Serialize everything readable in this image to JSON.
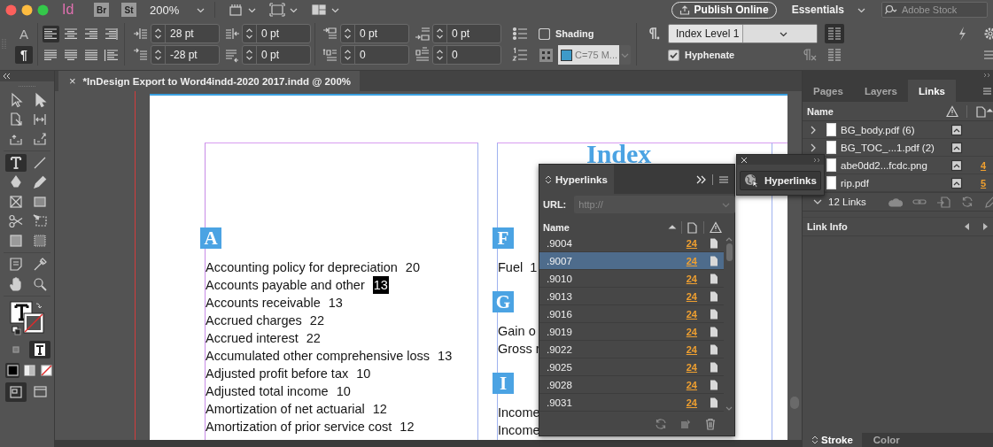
{
  "app_bar": {
    "logo": "Id",
    "apps": [
      "Br",
      "St"
    ],
    "zoom": "200%",
    "publish_button": "Publish Online",
    "workspace": "Essentials",
    "stock_search": {
      "placeholder": "Adobe Stock"
    }
  },
  "control_bar": {
    "modes": [
      {
        "label": "A",
        "selected": false
      },
      {
        "label": "¶",
        "selected": true
      }
    ],
    "alignment": [
      {
        "selected": true
      },
      {
        "selected": false
      },
      {
        "selected": false
      },
      {
        "selected": false
      },
      {
        "selected": false
      },
      {
        "selected": false
      },
      {
        "selected": false
      },
      {
        "selected": false
      }
    ],
    "spacing_fields": [
      {
        "value": "28 pt"
      },
      {
        "value": "-28 pt"
      },
      {
        "value": "0 pt"
      },
      {
        "value": "0 pt"
      },
      {
        "value": "0 pt"
      },
      {
        "value": "0"
      },
      {
        "value": "0 pt"
      },
      {
        "value": "0"
      }
    ],
    "shading": {
      "label": "Shading",
      "checked": false
    },
    "shading_color": {
      "value": "C=75 M..."
    },
    "paragraph_style": {
      "value": "Index Level 1"
    },
    "hyphenate": {
      "label": "Hyphenate",
      "checked": true
    },
    "column_modes": [
      {
        "selected": true
      },
      {
        "selected": false
      }
    ]
  },
  "document_tab": {
    "close": "×",
    "title": "*InDesign Export to Word4indd-2020 2017.indd @ 200%"
  },
  "tool_groups": [
    [
      {
        "kind": "selection",
        "selected": false
      },
      {
        "kind": "direct",
        "selected": false
      },
      {
        "kind": "page",
        "selected": false
      },
      {
        "kind": "gap",
        "selected": false
      },
      {
        "kind": "collector",
        "selected": false
      },
      {
        "kind": "placer",
        "selected": false
      }
    ],
    [
      {
        "kind": "type",
        "selected": true
      },
      {
        "kind": "line",
        "selected": false
      },
      {
        "kind": "pen",
        "selected": false
      },
      {
        "kind": "pencil",
        "selected": false
      },
      {
        "kind": "frame",
        "selected": false
      },
      {
        "kind": "rect",
        "selected": false
      },
      {
        "kind": "scissors",
        "selected": false
      },
      {
        "kind": "transform",
        "selected": false
      },
      {
        "kind": "gradient",
        "selected": false
      },
      {
        "kind": "feather",
        "selected": false
      }
    ],
    [
      {
        "kind": "note",
        "selected": false
      },
      {
        "kind": "eyedropper",
        "selected": false
      },
      {
        "kind": "hand",
        "selected": false
      },
      {
        "kind": "zoom",
        "selected": false
      }
    ]
  ],
  "format_targets": [
    {
      "selected": false
    },
    {
      "selected": true
    }
  ],
  "apply_modes": [
    {
      "selected": true
    },
    {
      "selected": false
    },
    {
      "selected": false
    }
  ],
  "view_modes": [
    {
      "selected": true
    },
    {
      "selected": false
    }
  ],
  "page": {
    "title": "Index",
    "left_column": [
      {
        "letter": "A",
        "entries": [
          {
            "term": "Accounting policy for depreciation",
            "page": "20",
            "highlighted": false
          },
          {
            "term": "Accounts payable and other",
            "page": "13",
            "highlighted": true
          },
          {
            "term": "Accounts receivable",
            "page": "13",
            "highlighted": false
          },
          {
            "term": "Accrued charges",
            "page": "22",
            "highlighted": false
          },
          {
            "term": "Accrued interest",
            "page": "22",
            "highlighted": false
          },
          {
            "term": "Accumulated other comprehensive loss",
            "page": "13",
            "highlighted": false
          },
          {
            "term": "Adjusted profit before tax",
            "page": "10",
            "highlighted": false
          },
          {
            "term": "Adjusted total income",
            "page": "10",
            "highlighted": false
          },
          {
            "term": "Amortization of net actuarial",
            "page": "12",
            "highlighted": false
          },
          {
            "term": "Amortization of prior service cost",
            "page": "12",
            "highlighted": false
          }
        ]
      }
    ],
    "right_column": [
      {
        "letter": "F",
        "entries": [
          "Fuel  1"
        ]
      },
      {
        "letter": "G",
        "entries": [
          "Gain o",
          "Gross r"
        ]
      },
      {
        "letter": "I",
        "entries": [
          "Income",
          "Income"
        ]
      }
    ]
  },
  "hyperlinks_panel": {
    "title": "Hyperlinks",
    "url_label": "URL:",
    "url": {
      "placeholder": "http://"
    },
    "column": "Name",
    "rows": [
      {
        "name": ".9004",
        "page": "24",
        "selected": false
      },
      {
        "name": ".9007",
        "page": "24",
        "selected": true
      },
      {
        "name": ".9010",
        "page": "24",
        "selected": false
      },
      {
        "name": ".9013",
        "page": "24",
        "selected": false
      },
      {
        "name": ".9016",
        "page": "24",
        "selected": false
      },
      {
        "name": ".9019",
        "page": "24",
        "selected": false
      },
      {
        "name": ".9022",
        "page": "24",
        "selected": false
      },
      {
        "name": ".9025",
        "page": "24",
        "selected": false
      },
      {
        "name": ".9028",
        "page": "24",
        "selected": false
      },
      {
        "name": ".9031",
        "page": "24",
        "selected": false
      }
    ]
  },
  "floating_panel": {
    "button": "Hyperlinks"
  },
  "links_panel": {
    "tabs": [
      {
        "label": "Pages",
        "selected": false
      },
      {
        "label": "Layers",
        "selected": false
      },
      {
        "label": "Links",
        "selected": true
      }
    ],
    "column": "Name",
    "rows": [
      {
        "kind": "group",
        "name": "BG_body.pdf (6)"
      },
      {
        "kind": "group",
        "name": "BG_TOC_...1.pdf (2)"
      },
      {
        "kind": "file",
        "name": "abe0dd2...fcdc.png",
        "page": "4"
      },
      {
        "kind": "file",
        "name": "rip.pdf",
        "page": "5"
      }
    ],
    "count": "12 Links",
    "info_title": "Link Info"
  },
  "bottom_panel": {
    "tabs": [
      {
        "label": "Stroke",
        "selected": true
      },
      {
        "label": "Color",
        "selected": false
      }
    ]
  }
}
